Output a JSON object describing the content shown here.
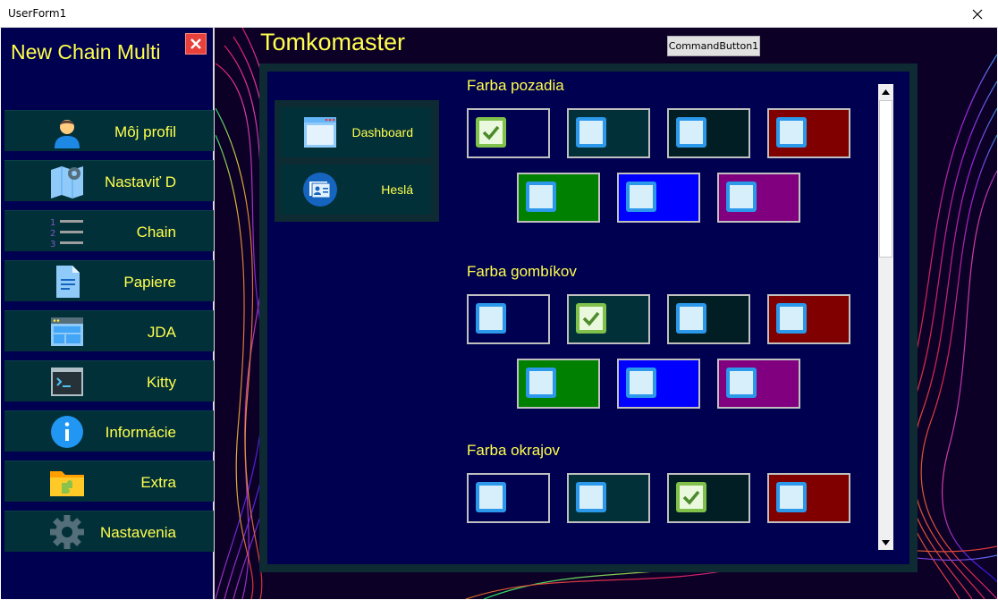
{
  "window": {
    "title": "UserForm1"
  },
  "sidebar": {
    "app_title": "New Chain Multi",
    "items": [
      {
        "label": "Môj profil",
        "icon": "user-icon"
      },
      {
        "label": "Nastaviť D",
        "icon": "map-settings-icon"
      },
      {
        "label": "Chain",
        "icon": "numbered-list-icon"
      },
      {
        "label": "Papiere",
        "icon": "document-icon"
      },
      {
        "label": "JDA",
        "icon": "browser-window-icon"
      },
      {
        "label": "Kitty",
        "icon": "terminal-icon"
      },
      {
        "label": "Informácie",
        "icon": "info-icon"
      },
      {
        "label": "Extra",
        "icon": "folder-puzzle-icon"
      },
      {
        "label": "Nastavenia",
        "icon": "gear-icon"
      }
    ]
  },
  "header": {
    "brand": "Tomkomaster",
    "command_button": "CommandButton1"
  },
  "subnav": {
    "items": [
      {
        "label": "Dashboard",
        "icon": "window-icon"
      },
      {
        "label": "Heslá",
        "icon": "id-card-icon"
      }
    ]
  },
  "sections": [
    {
      "title": "Farba pozadia",
      "swatches": [
        {
          "color": "#000050",
          "checked": true
        },
        {
          "color": "#023038",
          "checked": false
        },
        {
          "color": "#011e24",
          "checked": false
        },
        {
          "color": "#800000",
          "checked": false
        },
        {
          "color": "#008000",
          "checked": false
        },
        {
          "color": "#0000ff",
          "checked": false
        },
        {
          "color": "#800080",
          "checked": false
        }
      ]
    },
    {
      "title": "Farba gombíkov",
      "swatches": [
        {
          "color": "#000050",
          "checked": false
        },
        {
          "color": "#023038",
          "checked": true
        },
        {
          "color": "#011e24",
          "checked": false
        },
        {
          "color": "#800000",
          "checked": false
        },
        {
          "color": "#008000",
          "checked": false
        },
        {
          "color": "#0000ff",
          "checked": false
        },
        {
          "color": "#800080",
          "checked": false
        }
      ]
    },
    {
      "title": "Farba okrajov",
      "swatches": [
        {
          "color": "#000050",
          "checked": false
        },
        {
          "color": "#023038",
          "checked": false
        },
        {
          "color": "#011e24",
          "checked": true
        },
        {
          "color": "#800000",
          "checked": false
        }
      ]
    }
  ],
  "colors": {
    "accent_text": "#ffff4d",
    "sidebar_bg": "#000050",
    "tile_bg": "#023038"
  }
}
